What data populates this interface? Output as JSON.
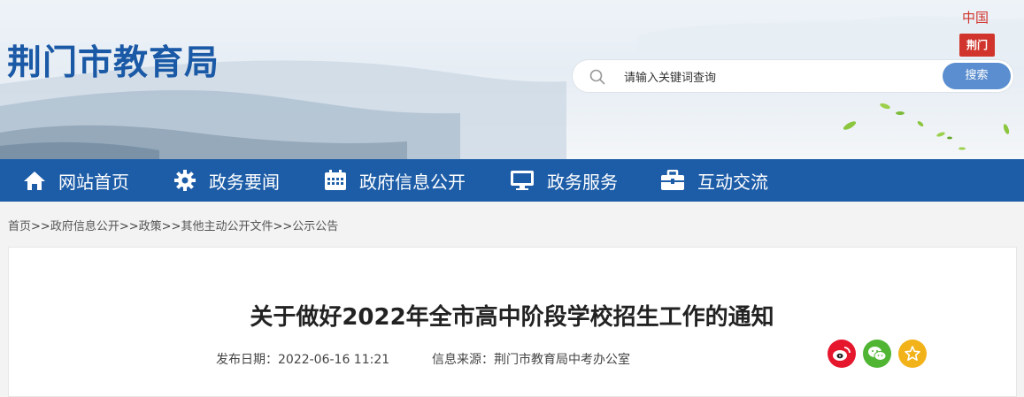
{
  "header": {
    "site_title": "荆门市教育局",
    "seal_top": "中国",
    "seal_box": "荆门",
    "search": {
      "placeholder": "请输入关键词查询",
      "button_label": "搜索"
    }
  },
  "nav": {
    "items": [
      {
        "label": "网站首页",
        "icon": "home-icon"
      },
      {
        "label": "政务要闻",
        "icon": "gear-icon"
      },
      {
        "label": "政府信息公开",
        "icon": "calendar-icon"
      },
      {
        "label": "政务服务",
        "icon": "monitor-icon"
      },
      {
        "label": "互动交流",
        "icon": "briefcase-icon"
      }
    ]
  },
  "breadcrumb": {
    "items": [
      "首页",
      "政府信息公开",
      "政策",
      "其他主动公开文件",
      "公示公告"
    ],
    "separator": ">>"
  },
  "article": {
    "title": "关于做好2022年全市高中阶段学校招生工作的通知",
    "date_label": "发布日期：2022-06-16 11:21",
    "source_label": "信息来源：荆门市教育局中考办公室"
  },
  "share": [
    {
      "icon": "weibo-icon",
      "color": "#e6162d"
    },
    {
      "icon": "wechat-icon",
      "color": "#4fb533"
    },
    {
      "icon": "star-icon",
      "color": "#f2b21a"
    }
  ],
  "colors": {
    "brand": "#1d5da8",
    "title_blue": "#1a59a6",
    "search_button": "#5a8ed0"
  }
}
